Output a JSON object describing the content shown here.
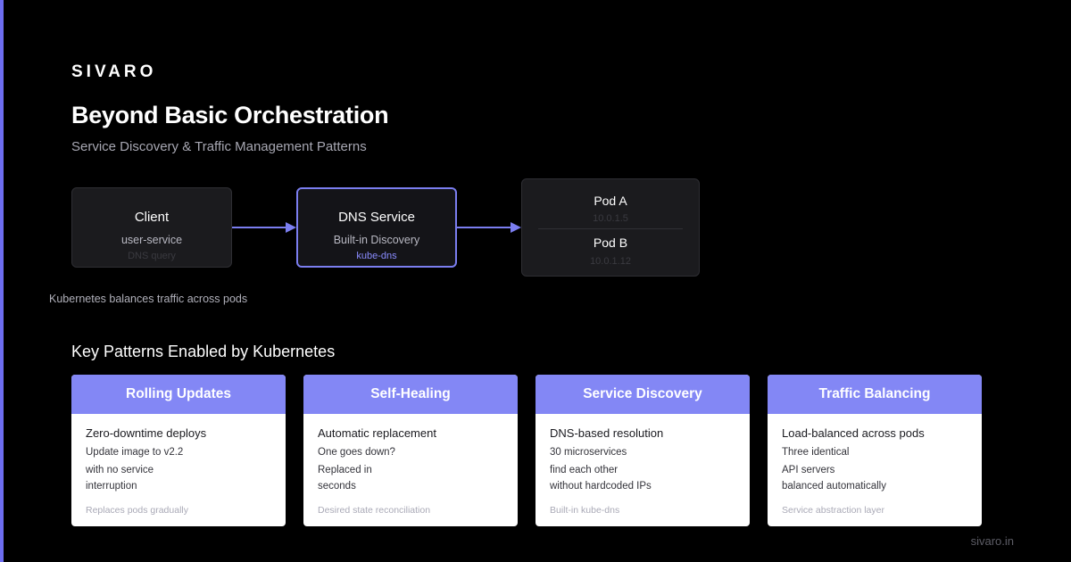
{
  "brand": "SIVARO",
  "title": "Beyond Basic Orchestration",
  "subtitle": "Service Discovery & Traffic Management Patterns",
  "diagram": {
    "client": {
      "name": "Client",
      "sub": "user-service",
      "note": "DNS query"
    },
    "dns": {
      "name": "DNS Service",
      "sub": "Built-in Discovery",
      "note": "kube-dns"
    },
    "pods": [
      {
        "name": "Pod A",
        "ip": "10.0.1.5"
      },
      {
        "name": "Pod B",
        "ip": "10.0.1.12"
      }
    ],
    "caption": "Kubernetes balances traffic across pods"
  },
  "section_title": "Key Patterns Enabled by Kubernetes",
  "cards": [
    {
      "title": "Rolling Updates",
      "lead": "Zero-downtime deploys",
      "lines": [
        "Update image to v2.2",
        "with no service",
        "interruption"
      ],
      "footnote": "Replaces pods gradually"
    },
    {
      "title": "Self-Healing",
      "lead": "Automatic replacement",
      "lines": [
        "One goes down?",
        "Replaced in",
        "seconds"
      ],
      "footnote": "Desired state reconciliation"
    },
    {
      "title": "Service Discovery",
      "lead": "DNS-based resolution",
      "lines": [
        "30 microservices",
        "find each other",
        "without hardcoded IPs"
      ],
      "footnote": "Built-in kube-dns"
    },
    {
      "title": "Traffic Balancing",
      "lead": "Load-balanced across pods",
      "lines": [
        "Three identical",
        "API servers",
        "balanced automatically"
      ],
      "footnote": "Service abstraction layer"
    }
  ],
  "footer": "sivaro.in",
  "colors": {
    "accent": "#7b7ef0",
    "card_header": "#8387f5",
    "background": "#000000"
  }
}
